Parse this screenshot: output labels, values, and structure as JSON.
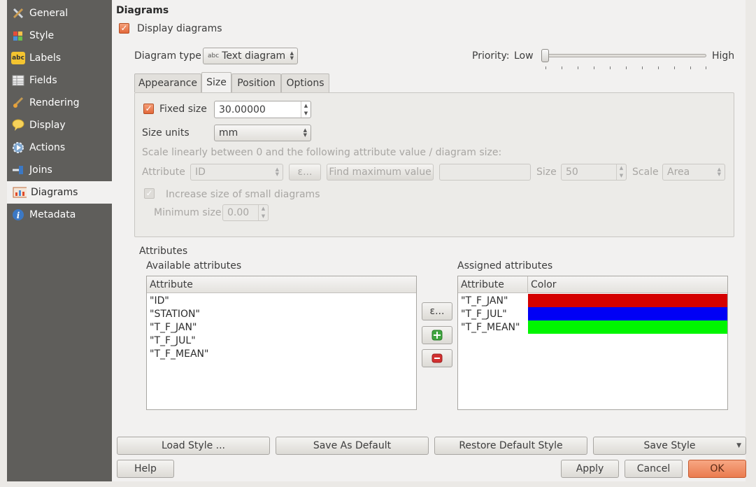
{
  "sidebar": {
    "items": [
      {
        "label": "General",
        "icon": "wrench-hammer-icon"
      },
      {
        "label": "Style",
        "icon": "paint-brush-icon"
      },
      {
        "label": "Labels",
        "icon": "abc-label-icon"
      },
      {
        "label": "Fields",
        "icon": "table-icon"
      },
      {
        "label": "Rendering",
        "icon": "brush-icon"
      },
      {
        "label": "Display",
        "icon": "speech-bubble-icon"
      },
      {
        "label": "Actions",
        "icon": "gear-play-icon"
      },
      {
        "label": "Joins",
        "icon": "join-icon"
      },
      {
        "label": "Diagrams",
        "icon": "diagram-icon"
      },
      {
        "label": "Metadata",
        "icon": "info-icon"
      }
    ],
    "selected": "Diagrams"
  },
  "section_title": "Diagrams",
  "display_diagrams": {
    "label": "Display diagrams",
    "checked": true
  },
  "diagram_type": {
    "label": "Diagram type",
    "value": "Text diagram",
    "icon_text": "abc"
  },
  "priority": {
    "label": "Priority:",
    "low": "Low",
    "high": "High",
    "value": 0
  },
  "tabs": [
    "Appearance",
    "Size",
    "Position",
    "Options"
  ],
  "active_tab": "Size",
  "size": {
    "fixed_size_label": "Fixed size",
    "fixed_size_checked": true,
    "fixed_size_value": "30.00000",
    "size_units_label": "Size units",
    "size_units_value": "mm",
    "scale_text": "Scale linearly between 0 and the following attribute value / diagram size:",
    "attribute_label": "Attribute",
    "attribute_value": "ID",
    "expr_button": "ε...",
    "find_max_button": "Find maximum value",
    "size_label": "Size",
    "size_value": "50",
    "scale_label": "Scale",
    "scale_value": "Area",
    "increase_label": "Increase size of small diagrams",
    "increase_checked": true,
    "min_size_label": "Minimum size",
    "min_size_value": "0.00"
  },
  "attributes": {
    "title": "Attributes",
    "available_title": "Available attributes",
    "available_header": "Attribute",
    "available": [
      "\"ID\"",
      "\"STATION\"",
      "\"T_F_JAN\"",
      "\"T_F_JUL\"",
      "\"T_F_MEAN\""
    ],
    "assigned_title": "Assigned attributes",
    "assigned_header_attr": "Attribute",
    "assigned_header_color": "Color",
    "assigned": [
      {
        "name": "\"T_F_JAN\"",
        "color": "#d40000"
      },
      {
        "name": "\"T_F_JUL\"",
        "color": "#0000f5"
      },
      {
        "name": "\"T_F_MEAN\"",
        "color": "#00f500"
      }
    ],
    "expr_button": "ε...",
    "add_icon": "plus-icon",
    "remove_icon": "minus-icon"
  },
  "buttons": {
    "load_style": "Load Style ...",
    "save_default": "Save As Default",
    "restore_default": "Restore Default Style",
    "save_style": "Save Style",
    "help": "Help",
    "apply": "Apply",
    "cancel": "Cancel",
    "ok": "OK"
  },
  "colors": {
    "accent": "#f08a60",
    "checkbox": "#e66f3e",
    "sidebar": "#5f5e5b"
  }
}
